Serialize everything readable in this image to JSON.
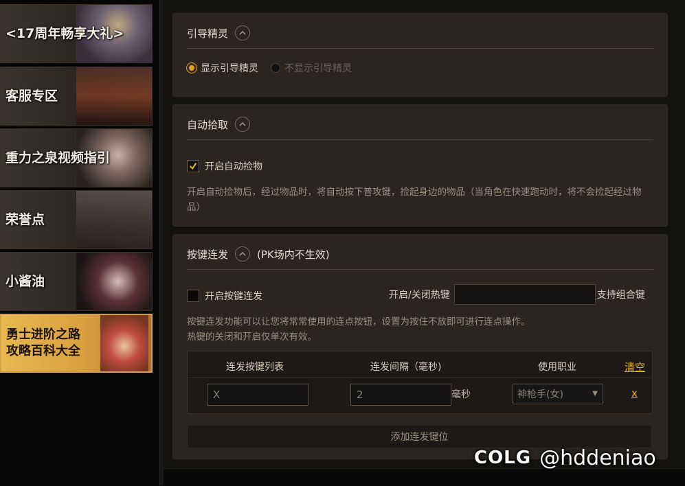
{
  "sidebar": {
    "banners": [
      {
        "label": "<17周年畅享大礼>"
      },
      {
        "label": "客服专区"
      },
      {
        "label": "重力之泉视频指引"
      },
      {
        "label": "荣誉点"
      },
      {
        "label": "小酱油"
      },
      {
        "label_line1": "勇士进阶之路",
        "label_line2": "攻略百科大全"
      }
    ]
  },
  "guide": {
    "title": "引导精灵",
    "options": [
      {
        "label": "显示引导精灵",
        "selected": true
      },
      {
        "label": "不显示引导精灵",
        "selected": false
      }
    ]
  },
  "autopickup": {
    "title": "自动拾取",
    "checkbox_label": "开启自动捡物",
    "checked": true,
    "description": "开启自动捡物后，经过物品时，将自动按下普攻键，捡起身边的物品（当角色在快速跑动时，将不会捡起经过物品）"
  },
  "autofire": {
    "title": "按键连发",
    "note": "(PK场内不生效)",
    "checkbox_label": "开启按键连发",
    "checked": false,
    "hotkey_label": "开启/关闭热键",
    "hotkey_value": "",
    "hotkey_hint": "支持组合键",
    "description_line1": "按键连发功能可以让您将常常使用的连点按钮，设置为按住不放即可进行连点操作。",
    "description_line2": "热键的关闭和开启仅单次有效。",
    "table": {
      "headers": [
        "连发按键列表",
        "连发间隔（毫秒)",
        "使用职业"
      ],
      "clear_label": "清空",
      "rows": [
        {
          "key": "X",
          "interval": "2",
          "unit": "毫秒",
          "job": "神枪手(女)",
          "delete": "x"
        }
      ]
    },
    "add_button": "添加连发键位"
  },
  "watermark": {
    "logo": "COLG",
    "handle": "@hddeniao"
  },
  "colors": {
    "accent": "#e8b020",
    "panel": "#2a2520",
    "background": "#14120f"
  }
}
